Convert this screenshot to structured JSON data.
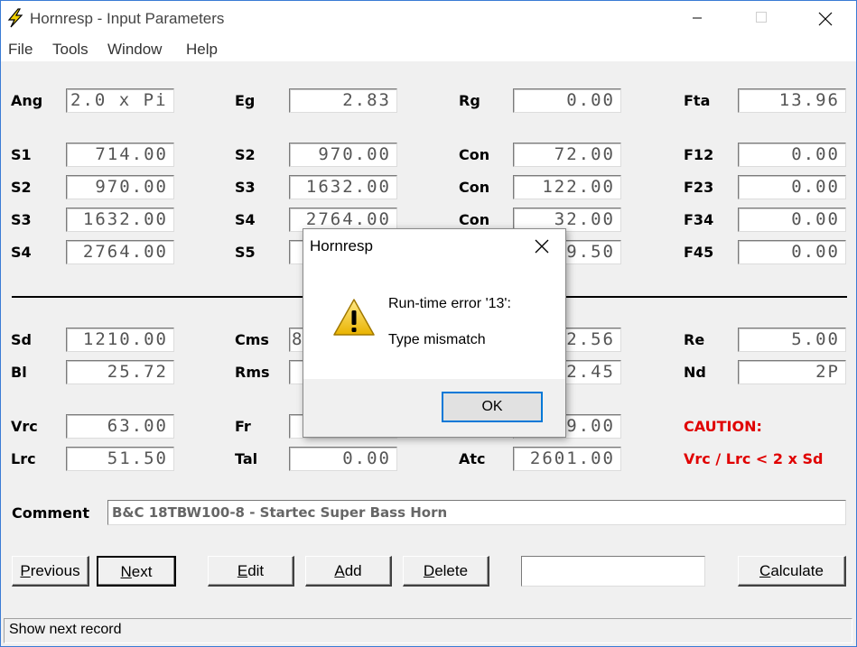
{
  "window": {
    "title": "Hornresp - Input Parameters"
  },
  "menu": [
    "File",
    "Tools",
    "Window",
    "Help"
  ],
  "labels": {
    "ang": "Ang",
    "eg": "Eg",
    "rg": "Rg",
    "fta": "Fta",
    "s1a": "S1",
    "s2a": "S2",
    "con1": "Con",
    "f12": "F12",
    "s2b": "S2",
    "s3a": "S3",
    "con2": "Con",
    "f23": "F23",
    "s3b": "S3",
    "s4a": "S4",
    "con3": "Con",
    "f34": "F34",
    "s4b": "S4",
    "s5a": "S5",
    "f45": "F45",
    "sd": "Sd",
    "cms": "Cms",
    "re": "Re",
    "bl": "Bl",
    "rms": "Rms",
    "nd": "Nd",
    "vrc": "Vrc",
    "fr": "Fr",
    "lrc": "Lrc",
    "tal": "Tal",
    "atc": "Atc",
    "comment": "Comment"
  },
  "values": {
    "ang": "2.0 x Pi",
    "eg": "2.83",
    "rg": "0.00",
    "fta": "13.96",
    "s1a": "714.00",
    "s2a": "970.00",
    "con1": "72.00",
    "f12": "0.00",
    "s2b": "970.00",
    "s3a": "1632.00",
    "con2": "122.00",
    "f23": "0.00",
    "s3b": "1632.00",
    "s4a": "2764.00",
    "con3": "32.00",
    "f34": "0.00",
    "s4b": "2764.00",
    "s5a": "",
    "s5b_partial": "9.50",
    "f45": "0.00",
    "sd": "1210.00",
    "cms": "8",
    "le_partial": "2.56",
    "re": "5.00",
    "bl": "25.72",
    "rms": "",
    "mmd_partial": "2.45",
    "nd": "2P",
    "vrc": "63.00",
    "fr": "",
    "vtc_partial": "9.00",
    "lrc": "51.50",
    "tal": "0.00",
    "atc": "2601.00"
  },
  "caution": {
    "title": "CAUTION:",
    "text": "Vrc / Lrc < 2 x Sd"
  },
  "comment": "B&C 18TBW100-8 - Startec Super Bass Horn",
  "buttons": {
    "previous": "Previous",
    "next": "Next",
    "edit": "Edit",
    "add": "Add",
    "delete": "Delete",
    "calculate": "Calculate"
  },
  "status": "Show next record",
  "dialog": {
    "title": "Hornresp",
    "line1": "Run-time error '13':",
    "line2": "Type mismatch",
    "ok": "OK",
    "icon": "warning-icon"
  },
  "colors": {
    "caution": "#e00000",
    "accent": "#0078d7"
  }
}
